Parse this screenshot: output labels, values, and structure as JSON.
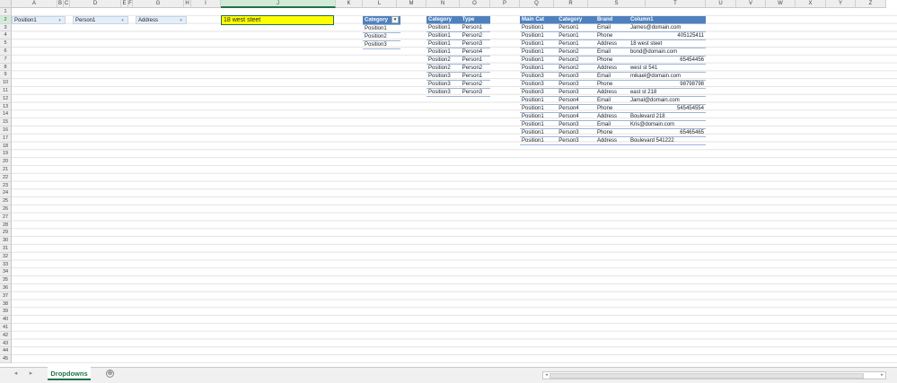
{
  "columns": [
    "A",
    "B",
    "C",
    "D",
    "E",
    "F",
    "G",
    "H",
    "I",
    "J",
    "K",
    "L",
    "M",
    "N",
    "O",
    "P",
    "Q",
    "R",
    "S",
    "T",
    "U",
    "V",
    "W",
    "X",
    "Y",
    "Z"
  ],
  "selected_column": "J",
  "selected_row": 2,
  "row_count": 45,
  "dropdown_cells": [
    {
      "value": "Position1"
    },
    {
      "value": "Person1"
    },
    {
      "value": "Address"
    }
  ],
  "result_cell": {
    "value": "18 west steet",
    "highlight": "#ffff00"
  },
  "category_table": {
    "header": "Category",
    "rows": [
      "Position1",
      "Position2",
      "Position3"
    ]
  },
  "type_table": {
    "headers": [
      "Category",
      "Type"
    ],
    "rows": [
      [
        "Position1",
        "Person1"
      ],
      [
        "Position1",
        "Person2"
      ],
      [
        "Position1",
        "Person3"
      ],
      [
        "Position1",
        "Person4"
      ],
      [
        "Position2",
        "Person1"
      ],
      [
        "Position2",
        "Person2"
      ],
      [
        "Position3",
        "Person1"
      ],
      [
        "Position3",
        "Person2"
      ],
      [
        "Position3",
        "Person3"
      ]
    ]
  },
  "main_table": {
    "headers": [
      "Main Cat",
      "Category",
      "Brand",
      "Column1"
    ],
    "rows": [
      [
        "Position1",
        "Person1",
        "Email",
        "James@domain.com"
      ],
      [
        "Position1",
        "Person1",
        "Phone",
        "405125411"
      ],
      [
        "Position1",
        "Person1",
        "Address",
        "18 west steet"
      ],
      [
        "Position1",
        "Person2",
        "Email",
        "bond@domain.com"
      ],
      [
        "Position1",
        "Person2",
        "Phone",
        "65454456"
      ],
      [
        "Position1",
        "Person2",
        "Address",
        "west st 541"
      ],
      [
        "Position3",
        "Person3",
        "Email",
        "mikael@domain.com"
      ],
      [
        "Position3",
        "Person3",
        "Phone",
        "98798798"
      ],
      [
        "Position3",
        "Person3",
        "Address",
        "east st 218"
      ],
      [
        "Position1",
        "Person4",
        "Email",
        "Jamal@domain.com"
      ],
      [
        "Position1",
        "Person4",
        "Phone",
        "545454554"
      ],
      [
        "Position1",
        "Person4",
        "Address",
        "Boulevard 218"
      ],
      [
        "Position1",
        "Person3",
        "Email",
        "Kris@domain.com"
      ],
      [
        "Position1",
        "Person3",
        "Phone",
        "65465465"
      ],
      [
        "Position1",
        "Person3",
        "Address",
        "Boulevard 541222"
      ]
    ]
  },
  "sheet_tab": "Dropdowns",
  "add_sheet_glyph": "⊕",
  "colors": {
    "header_blue": "#4f81bd",
    "excel_green": "#217346",
    "highlight": "#ffff00"
  }
}
